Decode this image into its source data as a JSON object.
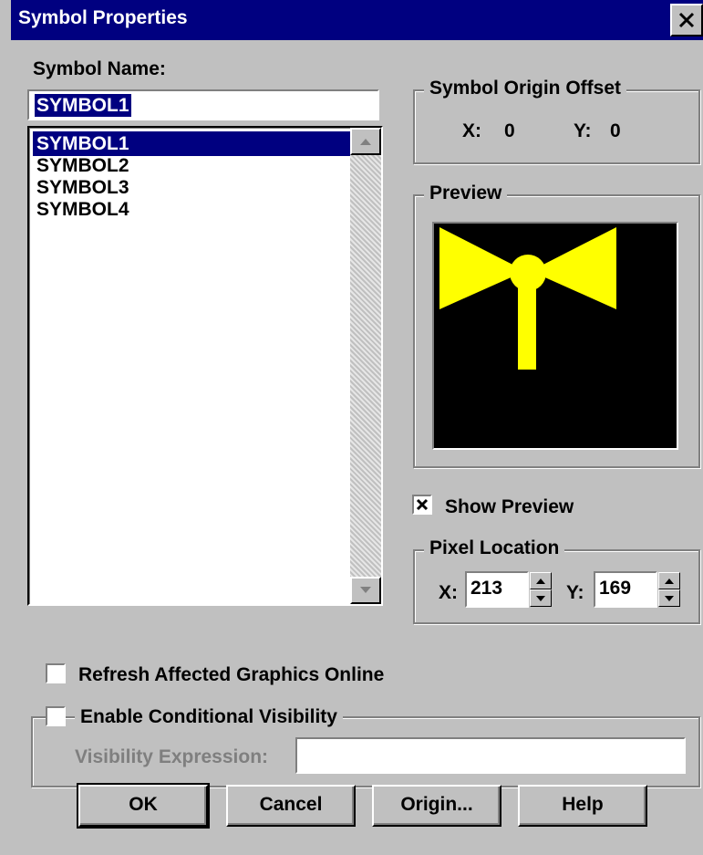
{
  "window": {
    "title": "Symbol Properties",
    "close_label": "close"
  },
  "symbol_name": {
    "label": "Symbol Name:",
    "value": "SYMBOL1",
    "list": [
      "SYMBOL1",
      "SYMBOL2",
      "SYMBOL3",
      "SYMBOL4"
    ],
    "selected_index": 0
  },
  "origin_offset": {
    "label": "Symbol Origin Offset",
    "x_label": "X:",
    "x_value": "0",
    "y_label": "Y:",
    "y_value": "0"
  },
  "preview": {
    "label": "Preview",
    "background": "#000000",
    "symbol_color": "#ffff00"
  },
  "show_preview": {
    "label": "Show Preview",
    "checked": true
  },
  "pixel_location": {
    "label": "Pixel Location",
    "x_label": "X:",
    "x_value": "213",
    "y_label": "Y:",
    "y_value": "169"
  },
  "refresh": {
    "label": "Refresh Affected Graphics Online",
    "checked": false
  },
  "conditional": {
    "label": "Enable Conditional Visibility",
    "checked": false,
    "expression_label": "Visibility Expression:",
    "expression_value": ""
  },
  "buttons": {
    "ok": "OK",
    "cancel": "Cancel",
    "origin": "Origin...",
    "help": "Help"
  },
  "colors": {
    "titlebar": "#000080",
    "face": "#c0c0c0",
    "selection": "#000080"
  }
}
